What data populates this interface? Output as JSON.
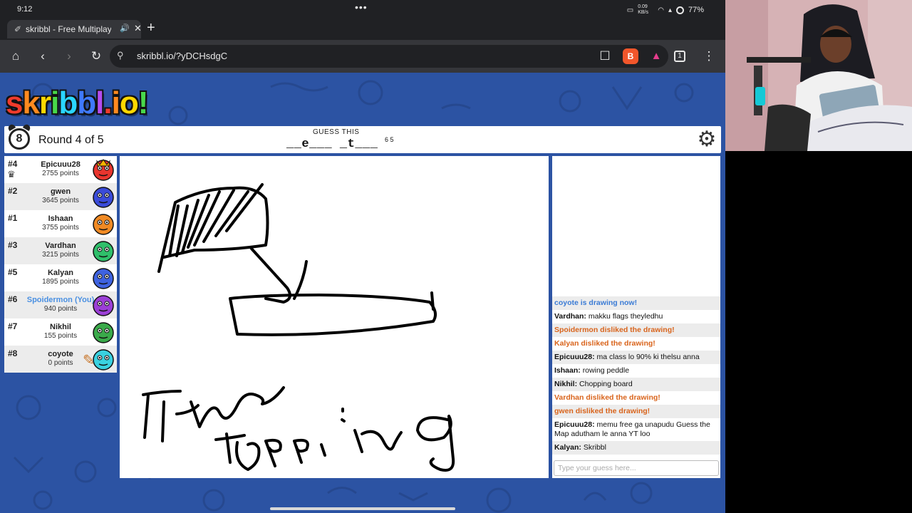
{
  "status": {
    "time": "9:12",
    "dots": "•••",
    "net": "0.09 KB/s",
    "battery": "77%"
  },
  "tab": {
    "title": "skribbl - Free Multiplayer",
    "speaker": "🔊",
    "close": "✕",
    "new": "+"
  },
  "toolbar": {
    "url": "skribbl.io/?yDCHsdgC",
    "tab_count": "1"
  },
  "game": {
    "logo": [
      "s",
      "k",
      "r",
      "i",
      "b",
      "b",
      "l",
      ".",
      "i",
      "o",
      "!"
    ],
    "logo_colors": [
      "#ef3b2c",
      "#ff8a1f",
      "#ffd800",
      "#48d84a",
      "#2ad6ff",
      "#3f79ff",
      "#b54cf0",
      "#ef3b2c",
      "#ff8a1f",
      "#ffd800",
      "#48d84a"
    ],
    "timer": "8",
    "round": "Round 4 of 5",
    "guess_label": "GUESS THIS",
    "word": "__e___ _t___",
    "word_lengths": "6 5",
    "settings_icon": "⚙"
  },
  "players": [
    {
      "rank": "#4",
      "name": "Epicuuu28",
      "points": "2755 points",
      "crown": true,
      "color": "#e8352e",
      "you": false,
      "drawing": false
    },
    {
      "rank": "#2",
      "name": "gwen",
      "points": "3645 points",
      "crown": false,
      "color": "#3a4bd9",
      "you": false,
      "drawing": false
    },
    {
      "rank": "#1",
      "name": "Ishaan",
      "points": "3755 points",
      "crown": false,
      "color": "#f08a24",
      "you": false,
      "drawing": false
    },
    {
      "rank": "#3",
      "name": "Vardhan",
      "points": "3215 points",
      "crown": false,
      "color": "#2fbf6a",
      "you": false,
      "drawing": false
    },
    {
      "rank": "#5",
      "name": "Kalyan",
      "points": "1895 points",
      "crown": false,
      "color": "#3e62e0",
      "you": false,
      "drawing": false
    },
    {
      "rank": "#6",
      "name": "Spoidermon (You)",
      "points": "940 points",
      "crown": false,
      "color": "#9b3fd6",
      "you": true,
      "drawing": false
    },
    {
      "rank": "#7",
      "name": "Nikhil",
      "points": "155 points",
      "crown": false,
      "color": "#3aaa4a",
      "you": false,
      "drawing": false
    },
    {
      "rank": "#8",
      "name": "coyote",
      "points": "0 points",
      "crown": false,
      "color": "#3ad1e0",
      "you": false,
      "drawing": true
    }
  ],
  "chat": [
    {
      "type": "sys-blue",
      "shade": true,
      "name": "",
      "text": "coyote is drawing now!"
    },
    {
      "type": "msg",
      "shade": false,
      "name": "Vardhan:",
      "text": "makku flags theyledhu"
    },
    {
      "type": "sys-orange",
      "shade": true,
      "name": "",
      "text": "Spoidermon disliked the drawing!"
    },
    {
      "type": "sys-orange",
      "shade": false,
      "name": "",
      "text": "Kalyan disliked the drawing!"
    },
    {
      "type": "msg",
      "shade": true,
      "name": "Epicuuu28:",
      "text": "ma class lo 90% ki thelsu anna"
    },
    {
      "type": "msg",
      "shade": false,
      "name": "Ishaan:",
      "text": "rowing peddle"
    },
    {
      "type": "msg",
      "shade": true,
      "name": "Nikhil:",
      "text": "Chopping board"
    },
    {
      "type": "sys-orange",
      "shade": false,
      "name": "",
      "text": "Vardhan disliked the drawing!"
    },
    {
      "type": "sys-orange",
      "shade": true,
      "name": "",
      "text": "gwen disliked the drawing!"
    },
    {
      "type": "msg",
      "shade": false,
      "name": "Epicuuu28:",
      "text": "memu free ga unapudu Guess the Map adutham le anna YT loo"
    },
    {
      "type": "msg",
      "shade": true,
      "name": "Kalyan:",
      "text": "Skribbl"
    }
  ],
  "chat_placeholder": "Type your guess here..."
}
